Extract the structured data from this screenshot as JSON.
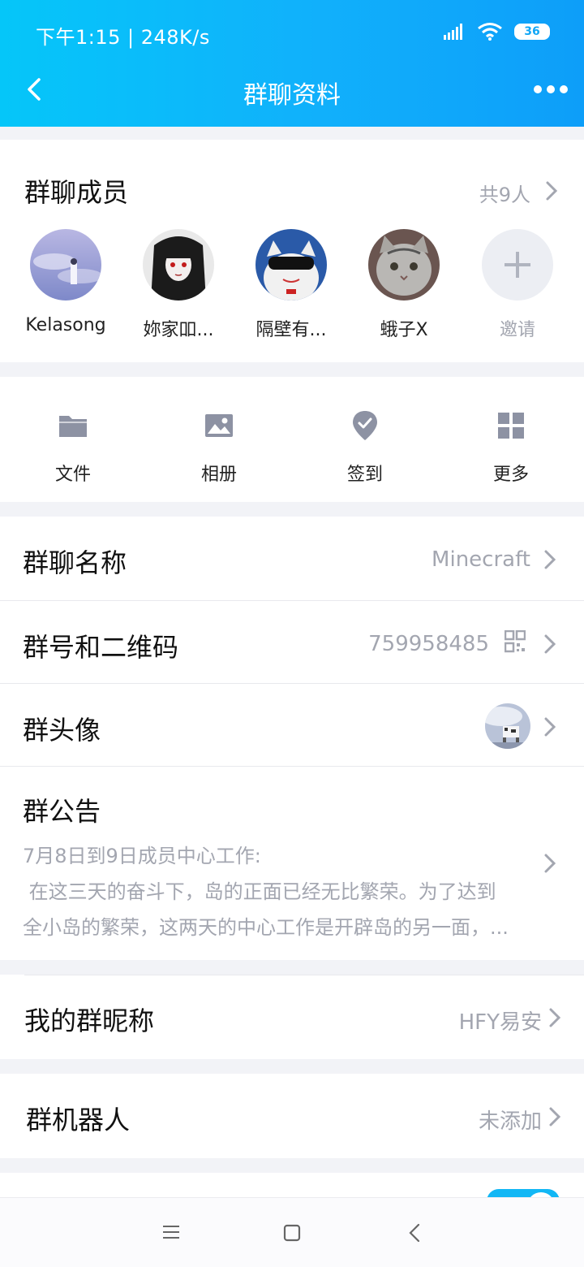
{
  "status_bar": {
    "time_speed": "下午1:15 | 248K/s",
    "battery": "36"
  },
  "header": {
    "title": "群聊资料"
  },
  "members": {
    "title": "群聊成员",
    "count": "共9人",
    "list": [
      {
        "name": "Kelasong"
      },
      {
        "name": "妳家吅..."
      },
      {
        "name": "隔壁有..."
      },
      {
        "name": "蛾子X"
      }
    ],
    "invite_label": "邀请"
  },
  "tools": [
    {
      "label": "文件",
      "icon": "folder-icon"
    },
    {
      "label": "相册",
      "icon": "image-icon"
    },
    {
      "label": "签到",
      "icon": "location-check-icon"
    },
    {
      "label": "更多",
      "icon": "grid-icon"
    }
  ],
  "rows": {
    "group_name": {
      "label": "群聊名称",
      "value": "Minecraft"
    },
    "group_id": {
      "label": "群号和二维码",
      "value": "759958485"
    },
    "group_avatar": {
      "label": "群头像"
    },
    "notice": {
      "label": "群公告",
      "line1": "7月8日到9日成员中心工作:",
      "line2": " 在这三天的奋斗下，岛的正面已经无比繁荣。为了达到",
      "line3": "全小岛的繁荣，这两天的中心工作是开辟岛的另一面，..."
    },
    "nickname": {
      "label": "我的群昵称",
      "value": "HFY易安"
    },
    "robot": {
      "label": "群机器人",
      "value": "未添加"
    }
  },
  "colors": {
    "header_start": "#05c6f9",
    "header_end": "#0d9ef9",
    "secondary_text": "#a3a6b0",
    "icon": "#8d92a3"
  }
}
